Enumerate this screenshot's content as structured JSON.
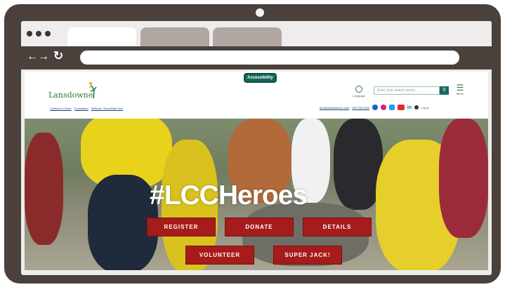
{
  "site": {
    "accessibility_label": "Accessibility",
    "logo_text": "Lansdowne",
    "sublinks": [
      "Children's Centre",
      "Foundation",
      "Referral / SmartStart Hub"
    ],
    "language_label": "Language",
    "search_placeholder": "Enter your search terms...",
    "menu_label": "Menu",
    "email": "info@lansdownecc.com",
    "phone": "519.753.3153",
    "login_label": "Log In",
    "social": [
      {
        "name": "facebook-icon",
        "color": "#1a5fd0"
      },
      {
        "name": "instagram-icon",
        "color": "#d6247a"
      },
      {
        "name": "twitter-icon",
        "color": "#1da1f2"
      },
      {
        "name": "youtube-icon",
        "color": "#e52d27"
      },
      {
        "name": "linkedin-icon",
        "color": "#0a66c2",
        "glyph": "in"
      }
    ]
  },
  "hero": {
    "hashtag": "#LCCHeroes",
    "buttons": [
      "REGISTER",
      "DONATE",
      "DETAILS",
      "VOLUNTEER",
      "SUPER JACK!"
    ],
    "button_color": "#a51c1a"
  }
}
